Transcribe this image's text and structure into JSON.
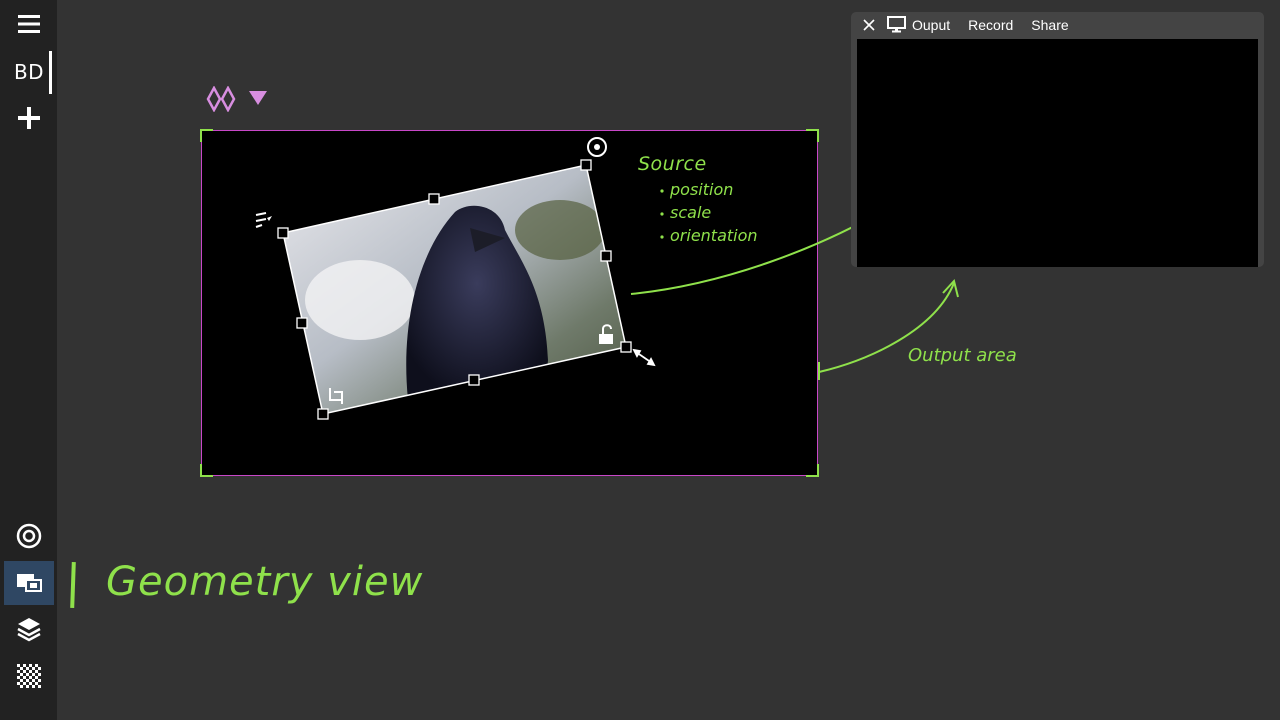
{
  "sidebar": {
    "items": [
      {
        "name": "menu",
        "icon": "hamburger-menu-icon"
      },
      {
        "name": "profile",
        "label": "BD"
      },
      {
        "name": "add",
        "icon": "plus-icon"
      },
      {
        "name": "target",
        "icon": "target-icon"
      },
      {
        "name": "geometry",
        "icon": "geometry-view-icon",
        "active": true
      },
      {
        "name": "layers",
        "icon": "layers-icon"
      },
      {
        "name": "transparency",
        "icon": "checkerboard-icon"
      }
    ]
  },
  "output_window": {
    "tabs": {
      "output": "Ouput",
      "record": "Record",
      "share": "Share"
    },
    "close_icon": "close-icon",
    "output_icon": "monitor-icon"
  },
  "canvas": {
    "toggle_icons": [
      "flip-icon",
      "dropdown-triangle-icon"
    ],
    "source_handles_icons": [
      "rotate-handle-icon",
      "align-menu-icon",
      "lock-icon",
      "crop-icon",
      "resize-arrow-icon"
    ]
  },
  "annotations": {
    "source_title": "Source",
    "source_bullets": [
      "position",
      "scale",
      "orientation"
    ],
    "output_area": "Output area",
    "geometry_view": "Geometry view"
  },
  "colors": {
    "annotation": "#8fe14b",
    "scene_border": "#c847c8",
    "accent_pink": "#d88ee0",
    "active_sidebar": "#2f4763"
  }
}
